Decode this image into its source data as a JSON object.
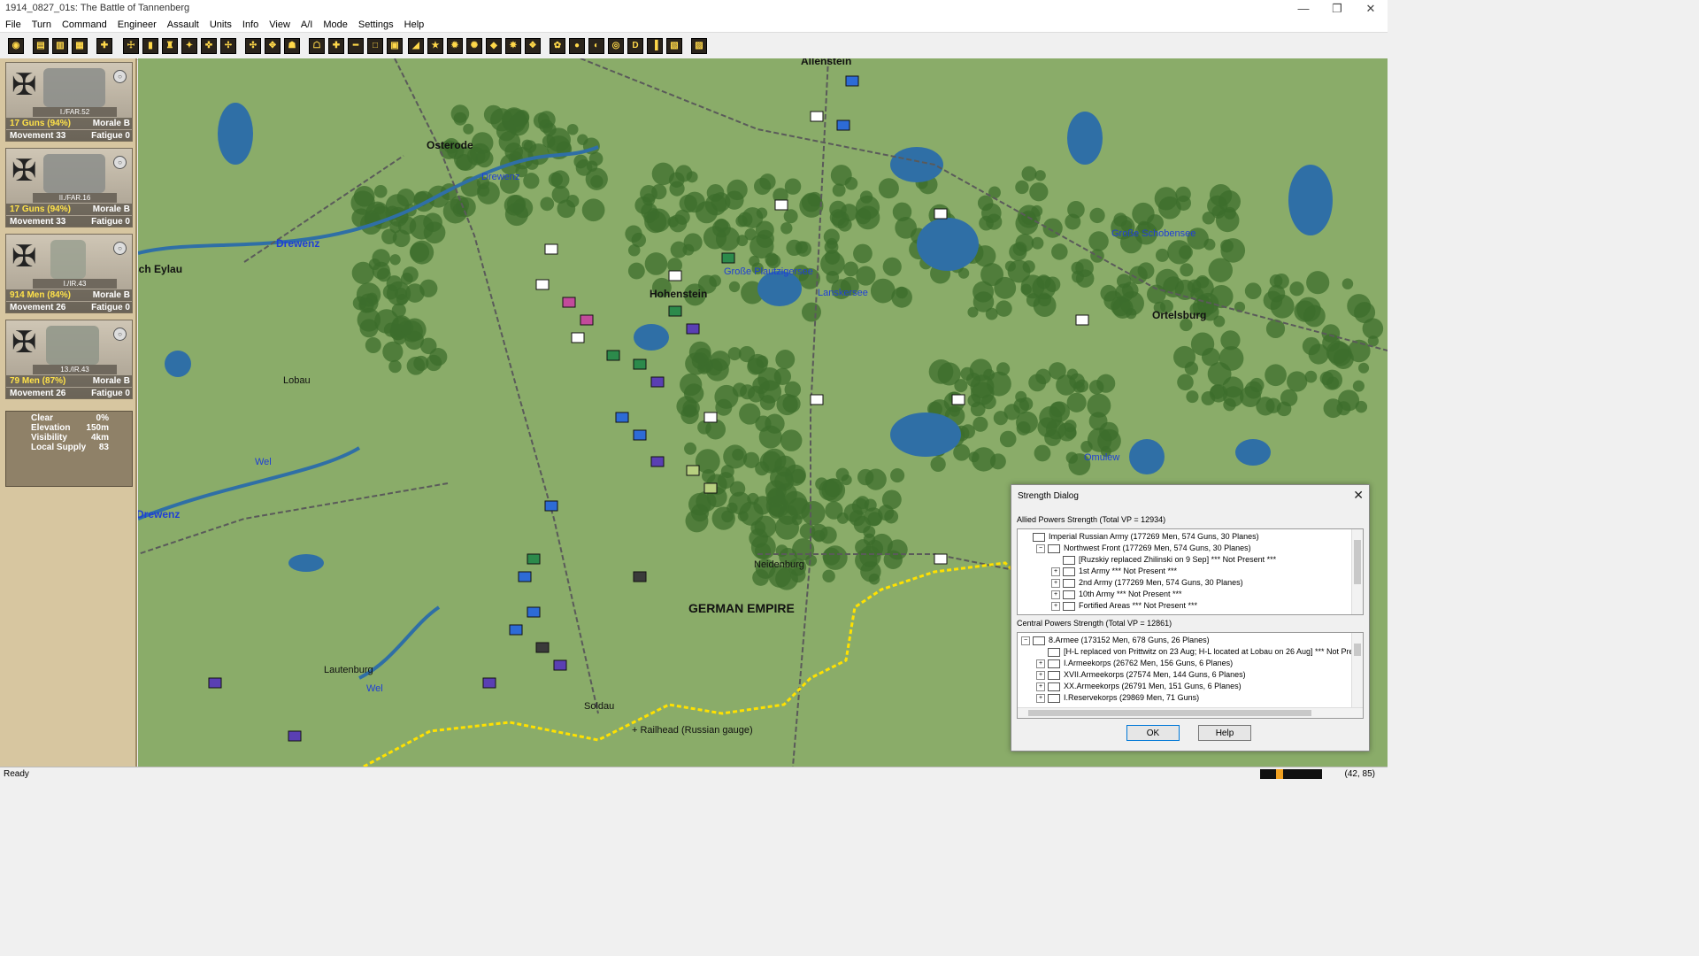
{
  "window": {
    "title": "1914_0827_01s: The Battle of Tannenberg",
    "controls": [
      "—",
      "❐",
      "✕"
    ]
  },
  "menu": [
    "File",
    "Turn",
    "Command",
    "Engineer",
    "Assault",
    "Units",
    "Info",
    "View",
    "A/I",
    "Mode",
    "Settings",
    "Help"
  ],
  "toolbar": {
    "buttons": [
      "◉",
      "▤",
      "▥",
      "▦",
      "✚",
      "☩",
      "▮",
      "♜",
      "✦",
      "✜",
      "✢",
      "✣",
      "✥",
      "☗",
      "☖",
      "✚",
      "━",
      "□",
      "▣",
      "◢",
      "★",
      "✹",
      "✺",
      "◆",
      "✸",
      "❖",
      "✿",
      "●",
      "◐",
      "◎",
      "D",
      "▐",
      "▧",
      "▨",
      "?"
    ]
  },
  "units": [
    {
      "name": "I./FAR.52",
      "strength": "17 Guns (94%)",
      "morale": "Morale B",
      "movement": "Movement 33",
      "fatigue": "Fatigue 0"
    },
    {
      "name": "II./FAR.16",
      "strength": "17 Guns (94%)",
      "morale": "Morale B",
      "movement": "Movement 33",
      "fatigue": "Fatigue 0"
    },
    {
      "name": "I./IR.43",
      "strength": "914 Men (84%)",
      "morale": "Morale B",
      "movement": "Movement 26",
      "fatigue": "Fatigue 0"
    },
    {
      "name": "13./IR.43",
      "strength": "79 Men (87%)",
      "morale": "Morale B",
      "movement": "Movement 26",
      "fatigue": "Fatigue 0"
    }
  ],
  "terrain": {
    "clear_label": "Clear",
    "clear_value": "0%",
    "elevation_label": "Elevation",
    "elevation_value": "150m",
    "visibility_label": "Visibility",
    "visibility_value": "4km",
    "supply_label": "Local Supply",
    "supply_value": "83"
  },
  "map": {
    "labels": [
      {
        "text": "Allenstein",
        "style": "bold"
      },
      {
        "text": "Osterode",
        "style": "bold"
      },
      {
        "text": "Drewenz",
        "style": "blue"
      },
      {
        "text": "Drewenz",
        "style": "blue bold"
      },
      {
        "text": "sch Eylau",
        "style": "bold"
      },
      {
        "text": "Hohenstein",
        "style": "bold"
      },
      {
        "text": "Große Plautzigersee",
        "style": "blue"
      },
      {
        "text": "Lanskersee",
        "style": "blue"
      },
      {
        "text": "Große Schobensee",
        "style": "blue"
      },
      {
        "text": "Ortelsburg",
        "style": "bold"
      },
      {
        "text": "Lobau",
        "style": "normal"
      },
      {
        "text": "Wel",
        "style": "blue"
      },
      {
        "text": "Drewenz",
        "style": "blue bold"
      },
      {
        "text": "Omulew",
        "style": "blue"
      },
      {
        "text": "Neidenburg",
        "style": "normal"
      },
      {
        "text": "GERMAN EMPIRE",
        "style": "big"
      },
      {
        "text": "Lautenburg",
        "style": "normal"
      },
      {
        "text": "Wel",
        "style": "blue"
      },
      {
        "text": "Soldau",
        "style": "normal"
      },
      {
        "text": "+ Railhead (Russian gauge)",
        "style": "normal"
      }
    ],
    "colors": {
      "clear": "#8aac69",
      "forest": "#3c6e2c",
      "water": "#2f6fa6",
      "border": "#ffe100",
      "rail": "#5a5a5a"
    }
  },
  "dialog": {
    "title": "Strength Dialog",
    "close": "✕",
    "allied_header": "Allied Powers Strength (Total VP = 12934)",
    "allied_tree": [
      {
        "text": "Imperial Russian Army (177269 Men, 574 Guns, 30 Planes)",
        "exp": "",
        "indent": 0
      },
      {
        "text": "Northwest Front (177269 Men, 574 Guns, 30 Planes)",
        "exp": "−",
        "indent": 1
      },
      {
        "text": "[Ruzskiy replaced Zhilinski on 9 Sep] *** Not Present ***",
        "exp": "",
        "indent": 2
      },
      {
        "text": "1st Army *** Not Present ***",
        "exp": "+",
        "indent": 2
      },
      {
        "text": "2nd Army (177269 Men, 574 Guns, 30 Planes)",
        "exp": "+",
        "indent": 2
      },
      {
        "text": "10th Army *** Not Present ***",
        "exp": "+",
        "indent": 2
      },
      {
        "text": "Fortified Areas *** Not Present ***",
        "exp": "+",
        "indent": 2
      }
    ],
    "central_header": "Central Powers Strength (Total VP = 12861)",
    "central_tree": [
      {
        "text": "8.Armee (173152 Men, 678 Guns, 26 Planes)",
        "exp": "−",
        "indent": 0
      },
      {
        "text": "[H-L replaced von Prittwitz on 23 Aug; H-L located at Lobau on 26 Aug] *** Not Pre",
        "exp": "",
        "indent": 1
      },
      {
        "text": "I.Armeekorps (26762 Men, 156 Guns, 6 Planes)",
        "exp": "+",
        "indent": 1
      },
      {
        "text": "XVII.Armeekorps (27574 Men, 144 Guns, 6 Planes)",
        "exp": "+",
        "indent": 1
      },
      {
        "text": "XX.Armeekorps (26791 Men, 151 Guns, 6 Planes)",
        "exp": "+",
        "indent": 1
      },
      {
        "text": "I.Reservekorps (29869 Men, 71 Guns)",
        "exp": "+",
        "indent": 1
      }
    ],
    "ok_label": "OK",
    "help_label": "Help"
  },
  "status": {
    "ready": "Ready",
    "coords": "(42, 85)"
  }
}
